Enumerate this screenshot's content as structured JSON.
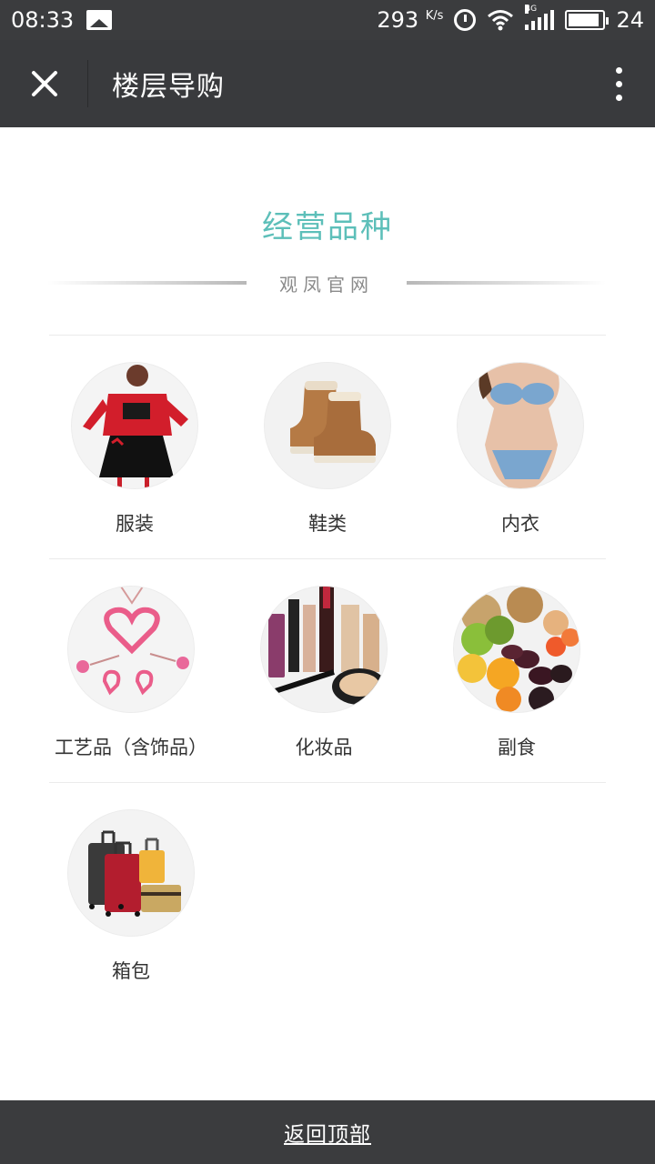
{
  "status_bar": {
    "time": "08:33",
    "speed": "293",
    "speed_unit": "K/s",
    "network": "4G",
    "battery": "24"
  },
  "title_bar": {
    "title": "楼层导购"
  },
  "section": {
    "heading": "经营品种",
    "subtitle": "观凤官网"
  },
  "categories": [
    {
      "label": "服装",
      "icon": "clothing-icon"
    },
    {
      "label": "鞋类",
      "icon": "boots-icon"
    },
    {
      "label": "内衣",
      "icon": "lingerie-icon"
    },
    {
      "label": "工艺品（含饰品）",
      "icon": "jewelry-icon"
    },
    {
      "label": "化妆品",
      "icon": "cosmetics-icon"
    },
    {
      "label": "副食",
      "icon": "dried-fruit-icon"
    },
    {
      "label": "箱包",
      "icon": "luggage-icon"
    }
  ],
  "footer": {
    "back_to_top": "返回顶部"
  },
  "colors": {
    "heading": "#5dbfb9",
    "bar": "#3b3c3e"
  }
}
